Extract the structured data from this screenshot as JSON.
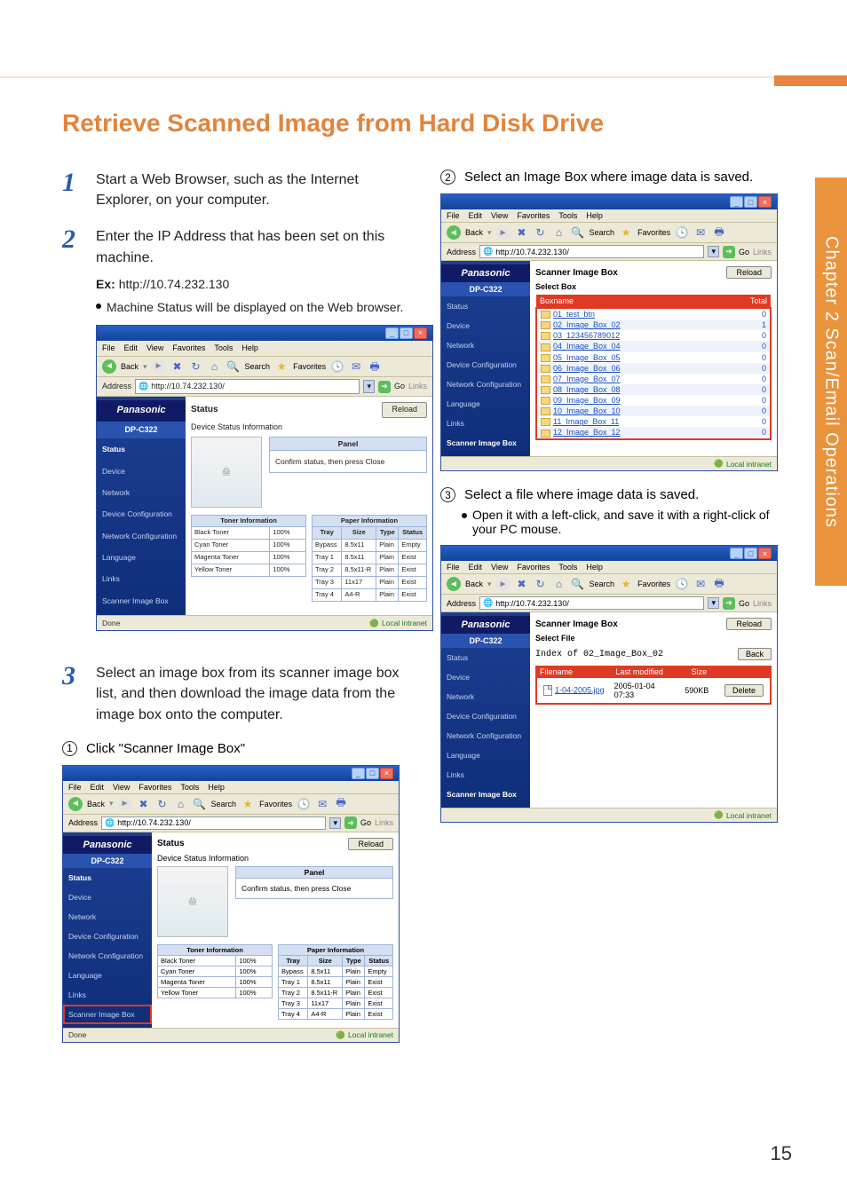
{
  "title": "Retrieve Scanned Image from Hard Disk Drive",
  "side_tab_text": "Chapter 2  Scan/Email Operations",
  "page_number": "15",
  "steps": {
    "s1": {
      "num": "1",
      "text": "Start a Web Browser, such as the Internet Explorer, on your computer."
    },
    "s2": {
      "num": "2",
      "text": "Enter the IP Address that has been set on this machine.",
      "ex_label": "Ex:",
      "ex_value": "http://10.74.232.130",
      "note": "Machine Status will be displayed on the Web browser."
    },
    "s3": {
      "num": "3",
      "text": "Select an image box from its scanner image box list, and then download the image data from the image box onto the computer.",
      "sub1_label": "①",
      "sub1_text": "Click \"Scanner Image Box\""
    },
    "s4": {
      "sub2_label": "②",
      "sub2_text": "Select an Image Box where image data is saved.",
      "sub3_label": "③",
      "sub3_text": "Select a file where image data is saved.",
      "sub3_note": "Open it with a left-click, and save it with a right-click of your PC mouse."
    }
  },
  "ie_common": {
    "menu": [
      "File",
      "Edit",
      "View",
      "Favorites",
      "Tools",
      "Help"
    ],
    "back_label": "Back",
    "search_label": "Search",
    "fav_label": "Favorites",
    "address_label": "Address",
    "url": "http://10.74.232.130/",
    "go_label": "Go",
    "links_label": "Links",
    "done_label": "Done",
    "zone_label": "Local intranet",
    "brand": "Panasonic",
    "model": "DP-C322",
    "reload_label": "Reload",
    "sidebar_items": [
      "Status",
      "Device",
      "Network",
      "Device Configuration",
      "Network Configuration",
      "Language",
      "Links",
      "Scanner Image Box"
    ]
  },
  "ie_status": {
    "title": "Status",
    "subtitle": "Device Status Information",
    "panel_header": "Panel",
    "panel_msg": "Confirm status, then press Close",
    "toner_header": "Toner Information",
    "toner_rows": [
      [
        "Black Toner",
        "100%"
      ],
      [
        "Cyan Toner",
        "100%"
      ],
      [
        "Magenta Toner",
        "100%"
      ],
      [
        "Yellow Toner",
        "100%"
      ]
    ],
    "paper_header": "Paper Information",
    "paper_cols": [
      "Tray",
      "Size",
      "Type",
      "Status"
    ],
    "paper_rows": [
      [
        "Bypass",
        "8.5x11",
        "Plain",
        "Empty"
      ],
      [
        "Tray 1",
        "8.5x11",
        "Plain",
        "Exist"
      ],
      [
        "Tray 2",
        "8.5x11-R",
        "Plain",
        "Exist"
      ],
      [
        "Tray 3",
        "11x17",
        "Plain",
        "Exist"
      ],
      [
        "Tray 4",
        "A4-R",
        "Plain",
        "Exist"
      ]
    ]
  },
  "ie_boxes": {
    "title": "Scanner Image Box",
    "subtitle": "Select Box",
    "col_name": "Boxname",
    "col_total": "Total",
    "rows": [
      {
        "name": "01_test_btn",
        "total": "0"
      },
      {
        "name": "02_Image_Box_02",
        "total": "1"
      },
      {
        "name": "03_123456789012",
        "total": "0"
      },
      {
        "name": "04_Image_Box_04",
        "total": "0"
      },
      {
        "name": "05_Image_Box_05",
        "total": "0"
      },
      {
        "name": "06_Image_Box_06",
        "total": "0"
      },
      {
        "name": "07_Image_Box_07",
        "total": "0"
      },
      {
        "name": "08_Image_Box_08",
        "total": "0"
      },
      {
        "name": "09_Image_Box_09",
        "total": "0"
      },
      {
        "name": "10_Image_Box_10",
        "total": "0"
      },
      {
        "name": "11_Image_Box_11",
        "total": "0"
      },
      {
        "name": "12_Image_Box_12",
        "total": "0"
      }
    ]
  },
  "ie_files": {
    "title": "Scanner Image Box",
    "subtitle": "Select File",
    "index_label": "Index of 02_Image_Box_02",
    "back_label": "Back",
    "col_name": "Filename",
    "col_mod": "Last modified",
    "col_size": "Size",
    "file_name": "1-04-2005.jpg",
    "file_mod": "2005-01-04 07:33",
    "file_size": "590KB",
    "delete_label": "Delete"
  }
}
